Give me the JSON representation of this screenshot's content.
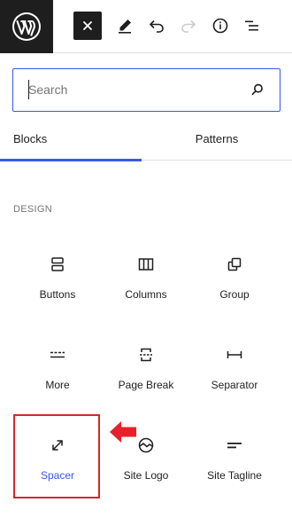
{
  "toolbar": {
    "logo_icon": "wordpress-logo-icon",
    "buttons": [
      {
        "name": "close-inserter-button",
        "icon": "close-icon"
      },
      {
        "name": "tools-button",
        "icon": "pencil-icon"
      },
      {
        "name": "undo-button",
        "icon": "undo-icon"
      },
      {
        "name": "redo-button",
        "icon": "redo-icon",
        "disabled": true
      },
      {
        "name": "details-button",
        "icon": "info-icon"
      },
      {
        "name": "list-view-button",
        "icon": "list-view-icon"
      }
    ]
  },
  "search": {
    "placeholder": "Search",
    "value": "",
    "icon": "search-icon"
  },
  "tabs": [
    {
      "label": "Blocks",
      "active": true
    },
    {
      "label": "Patterns",
      "active": false
    }
  ],
  "category": {
    "label": "DESIGN"
  },
  "blocks": [
    {
      "label": "Buttons",
      "icon": "buttons-icon"
    },
    {
      "label": "Columns",
      "icon": "columns-icon"
    },
    {
      "label": "Group",
      "icon": "group-icon"
    },
    {
      "label": "More",
      "icon": "more-icon"
    },
    {
      "label": "Page Break",
      "icon": "page-break-icon"
    },
    {
      "label": "Separator",
      "icon": "separator-icon"
    },
    {
      "label": "Spacer",
      "icon": "spacer-icon",
      "selected": true
    },
    {
      "label": "Site Logo",
      "icon": "site-logo-icon"
    },
    {
      "label": "Site Tagline",
      "icon": "site-tagline-icon"
    }
  ],
  "colors": {
    "accent": "#3858e9",
    "highlight": "#d9262a",
    "dark": "#1e1e1e",
    "muted": "#757575"
  }
}
